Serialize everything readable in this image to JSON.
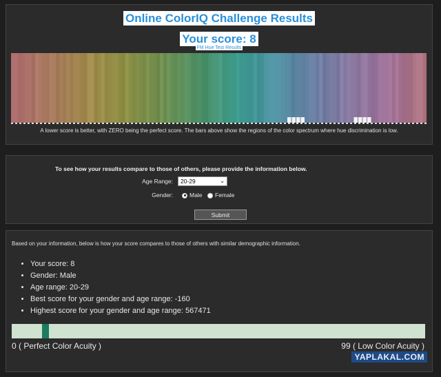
{
  "results": {
    "title": "Online ColorIQ Challenge Results",
    "score_text": "Your score: 8",
    "fm_link": "FM Hue Test Results",
    "caption": "A lower score is better, with ZERO being the perfect score. The bars above show the regions of the color spectrum where hue discrimination is low."
  },
  "spectrum": {
    "stops": [
      "#b06f70",
      "#a87a5f",
      "#a28a4c",
      "#8d8f45",
      "#6f8f50",
      "#4f9268",
      "#3b9a8d",
      "#4d90a2",
      "#6a80a5",
      "#8878a0",
      "#a0729a",
      "#b07580"
    ],
    "error_bins": [
      {
        "position": 0.665,
        "blocks": 4
      },
      {
        "position": 0.825,
        "blocks": 4
      }
    ]
  },
  "form": {
    "heading": "To see how your results compare to those of others, please provide the information below.",
    "age_label": "Age Range:",
    "age_value": "20-29",
    "gender_label": "Gender:",
    "male_label": "Male",
    "female_label": "Female",
    "selected_gender": "Male",
    "submit_label": "Submit"
  },
  "compare": {
    "intro": "Based on your information, below is how your score compares to those of others with similar demographic information.",
    "items": [
      "Your score: 8",
      "Gender: Male",
      "Age range: 20-29",
      "Best score for your gender and age range: -160",
      "Highest score for your gender and age range: 567471"
    ],
    "acuity_value": 8,
    "acuity_max": 99,
    "left_label": "0 ( Perfect Color Acuity )",
    "right_label": "99 ( Low Color Acuity )"
  },
  "watermark": "YAPLAKAL.COM"
}
